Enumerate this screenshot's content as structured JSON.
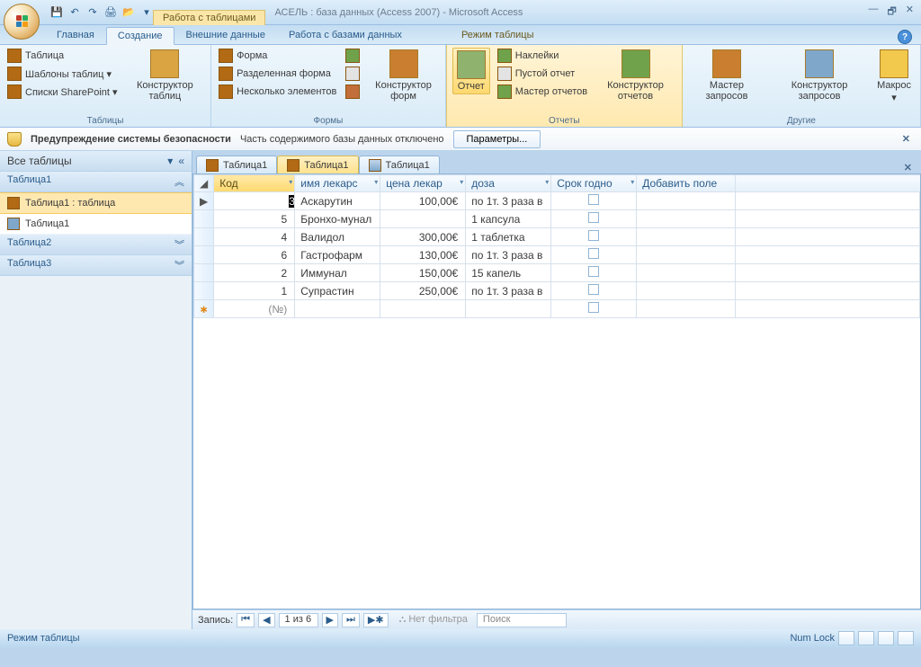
{
  "titlebar": {
    "context_title": "Работа с таблицами",
    "app_title": "АСЕЛЬ : база данных (Access 2007) - Microsoft Access"
  },
  "tabs": {
    "home": "Главная",
    "create": "Создание",
    "external": "Внешние данные",
    "dbtools": "Работа с базами данных",
    "datasheet": "Режим таблицы"
  },
  "ribbon": {
    "tables": {
      "table": "Таблица",
      "templates": "Шаблоны таблиц ▾",
      "sharepoint": "Списки SharePoint ▾",
      "designer": "Конструктор таблиц",
      "label": "Таблицы"
    },
    "forms": {
      "form": "Форма",
      "split": "Разделенная форма",
      "multi": "Несколько элементов",
      "designer": "Конструктор форм",
      "label": "Формы"
    },
    "reports": {
      "report": "Отчет",
      "labels": "Наклейки",
      "blank": "Пустой отчет",
      "wizard": "Мастер отчетов",
      "designer": "Конструктор отчетов",
      "label": "Отчеты"
    },
    "other": {
      "qwizard": "Мастер запросов",
      "qdesigner": "Конструктор запросов",
      "macro": "Макрос",
      "label": "Другие"
    }
  },
  "security": {
    "warn": "Предупреждение системы безопасности",
    "msg": "Часть содержимого базы данных отключено",
    "params": "Параметры..."
  },
  "nav": {
    "header": "Все таблицы",
    "g1": "Таблица1",
    "g1_item1": "Таблица1 : таблица",
    "g1_item2": "Таблица1",
    "g2": "Таблица2",
    "g3": "Таблица3"
  },
  "doc_tabs": {
    "t1": "Таблица1",
    "t2": "Таблица1",
    "t3": "Таблица1"
  },
  "grid": {
    "cols": {
      "id": "Код",
      "name": "имя лекарс",
      "price": "цена лекар",
      "dose": "доза",
      "expiry": "Срок годно",
      "add": "Добавить поле"
    },
    "rows": [
      {
        "id": "3",
        "name": "Аскарутин",
        "price": "100,00€",
        "dose": "по 1т. 3 раза в"
      },
      {
        "id": "5",
        "name": "Бронхо-мунал",
        "price": "",
        "dose": "1 капсула"
      },
      {
        "id": "4",
        "name": "Валидол",
        "price": "300,00€",
        "dose": "1 таблетка"
      },
      {
        "id": "6",
        "name": "Гастрофарм",
        "price": "130,00€",
        "dose": "по 1т. 3 раза в"
      },
      {
        "id": "2",
        "name": "Иммунал",
        "price": "150,00€",
        "dose": "15 капель"
      },
      {
        "id": "1",
        "name": "Супрастин",
        "price": "250,00€",
        "dose": "по 1т. 3 раза в"
      }
    ],
    "newrow_id": "(№)"
  },
  "recnav": {
    "label": "Запись:",
    "counter": "1 из 6",
    "nofilter": "Нет фильтра",
    "search": "Поиск"
  },
  "status": {
    "mode": "Режим таблицы",
    "numlock": "Num Lock"
  }
}
